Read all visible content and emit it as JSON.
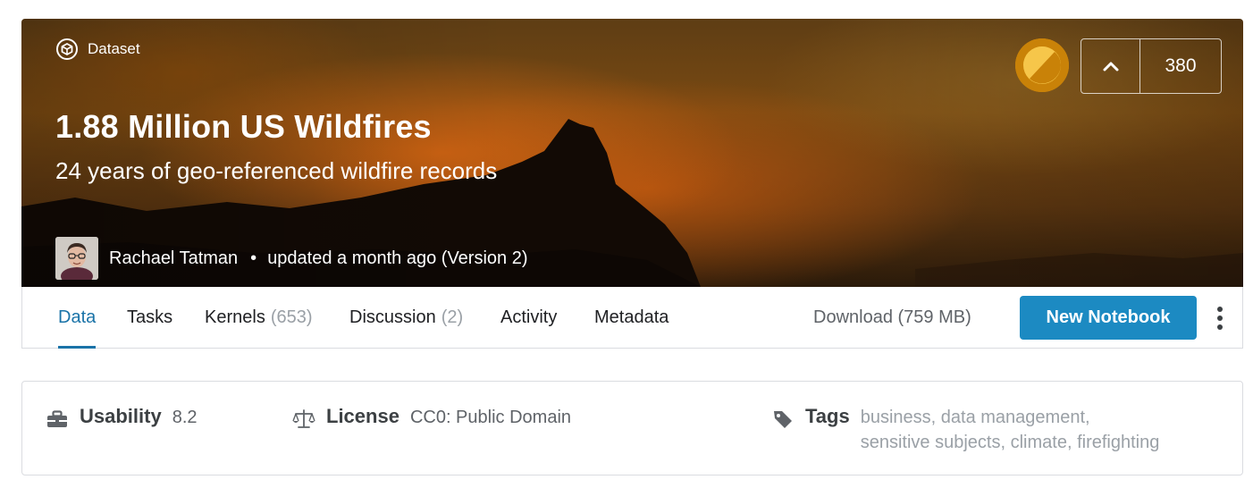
{
  "hero": {
    "dataset_label": "Dataset",
    "title": "1.88 Million US Wildfires",
    "subtitle": "24 years of geo-referenced wildfire records",
    "author": "Rachael Tatman",
    "separator": "•",
    "updated": "updated a month ago (Version 2)",
    "vote_count": "380"
  },
  "tabs": [
    {
      "label": "Data",
      "count": "",
      "active": true
    },
    {
      "label": "Tasks",
      "count": "",
      "active": false
    },
    {
      "label": "Kernels",
      "count": "(653)",
      "active": false
    },
    {
      "label": "Discussion",
      "count": "(2)",
      "active": false
    },
    {
      "label": "Activity",
      "count": "",
      "active": false
    },
    {
      "label": "Metadata",
      "count": "",
      "active": false
    }
  ],
  "actions": {
    "download": "Download (759 MB)",
    "new_notebook": "New Notebook"
  },
  "info": {
    "usability_label": "Usability",
    "usability_value": "8.2",
    "license_label": "License",
    "license_value": "CC0: Public Domain",
    "tags_label": "Tags",
    "tags": [
      "business",
      "data management",
      "sensitive subjects",
      "climate",
      "firefighting"
    ]
  },
  "colors": {
    "accent": "#1a73a8",
    "button": "#1c8ac2",
    "medal": "#d38a0b"
  },
  "icons": {
    "dataset": "dataset-cube-icon",
    "vote": "chevron-up-icon",
    "usability": "toolbox-icon",
    "license": "scales-icon",
    "tags": "tag-icon",
    "menu": "more-vertical-icon"
  }
}
